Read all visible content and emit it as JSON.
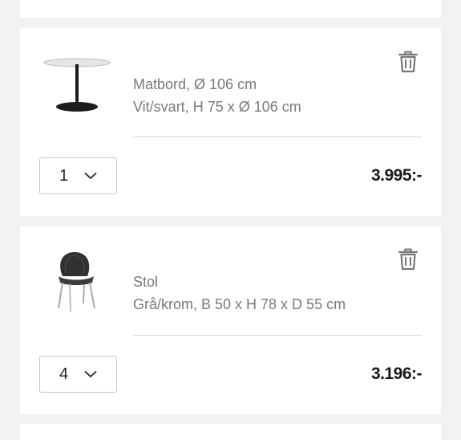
{
  "cart": {
    "items": [
      {
        "name": "Matbord, Ø 106 cm",
        "variant": "Vit/svart, H 75 x Ø 106 cm",
        "quantity": "1",
        "price": "3.995:-",
        "image_icon": "round-table-image"
      },
      {
        "name": "Stol",
        "variant": "Grå/krom, B 50 x H 78 x D 55 cm",
        "quantity": "4",
        "price": "3.196:-",
        "image_icon": "chair-image"
      }
    ]
  },
  "icons": {
    "remove": "trash-icon",
    "dropdown": "chevron-down-icon"
  },
  "colors": {
    "background": "#f2f2f2",
    "card": "#ffffff",
    "muted_text": "#7a7a7a",
    "price_text": "#1a1a1a"
  }
}
